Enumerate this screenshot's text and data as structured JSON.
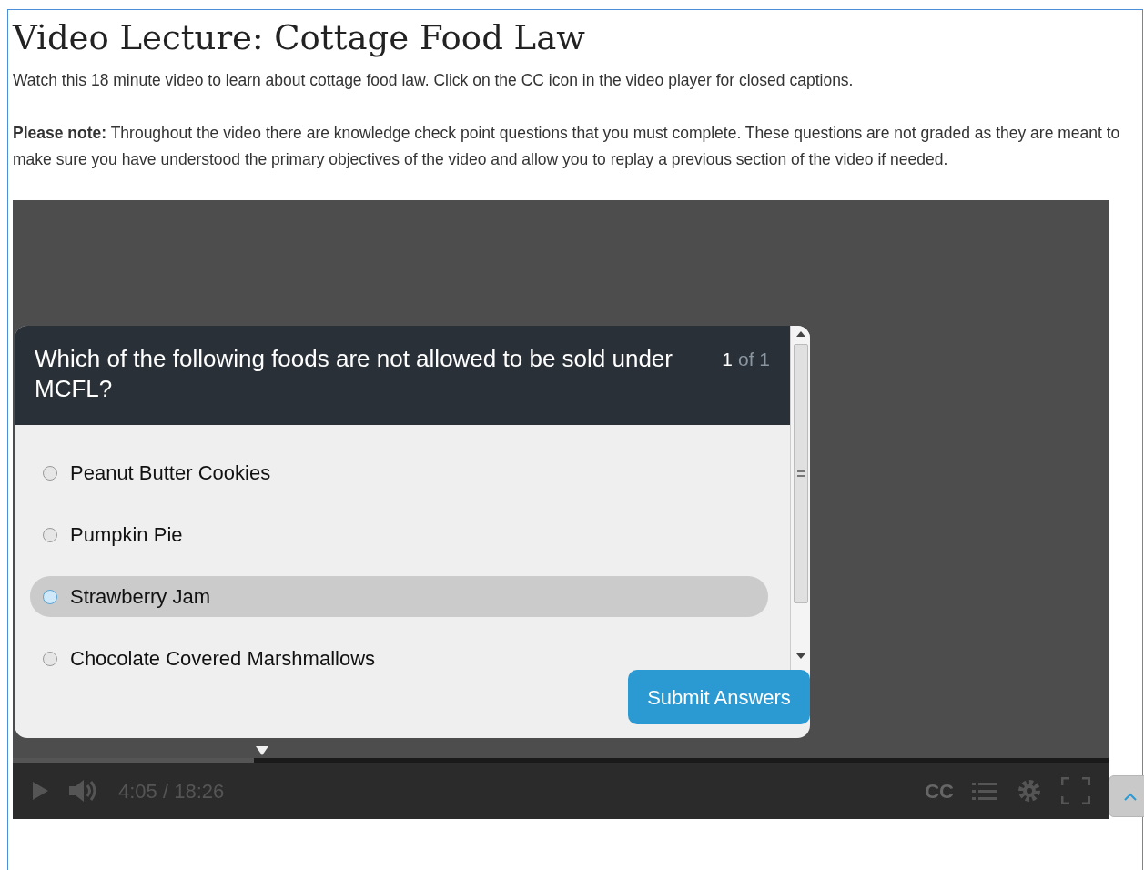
{
  "page": {
    "title": "Video Lecture: Cottage Food Law",
    "intro": "Watch this 18 minute video to learn about cottage food law. Click on the CC icon in the video player for closed captions.",
    "note": "**Please note:** Throughout the video there are knowledge check point questions that you must complete. These questions are not graded as they are meant to make sure you have understood the primary objectives of the video and allow you to replay a previous section of the video if needed."
  },
  "quiz": {
    "question": "Which of the following foods are not allowed to be sold under MCFL?",
    "current": "1",
    "total": "of 1",
    "options": [
      {
        "label": "Peanut Butter Cookies",
        "selected": false
      },
      {
        "label": "Pumpkin Pie",
        "selected": false
      },
      {
        "label": "Strawberry Jam",
        "selected": true
      },
      {
        "label": "Chocolate Covered Marshmallows",
        "selected": false
      }
    ],
    "submit": "Submit Answers"
  },
  "player": {
    "level": 0.22,
    "time": "4:05 / 18:26",
    "cc": "CC"
  }
}
